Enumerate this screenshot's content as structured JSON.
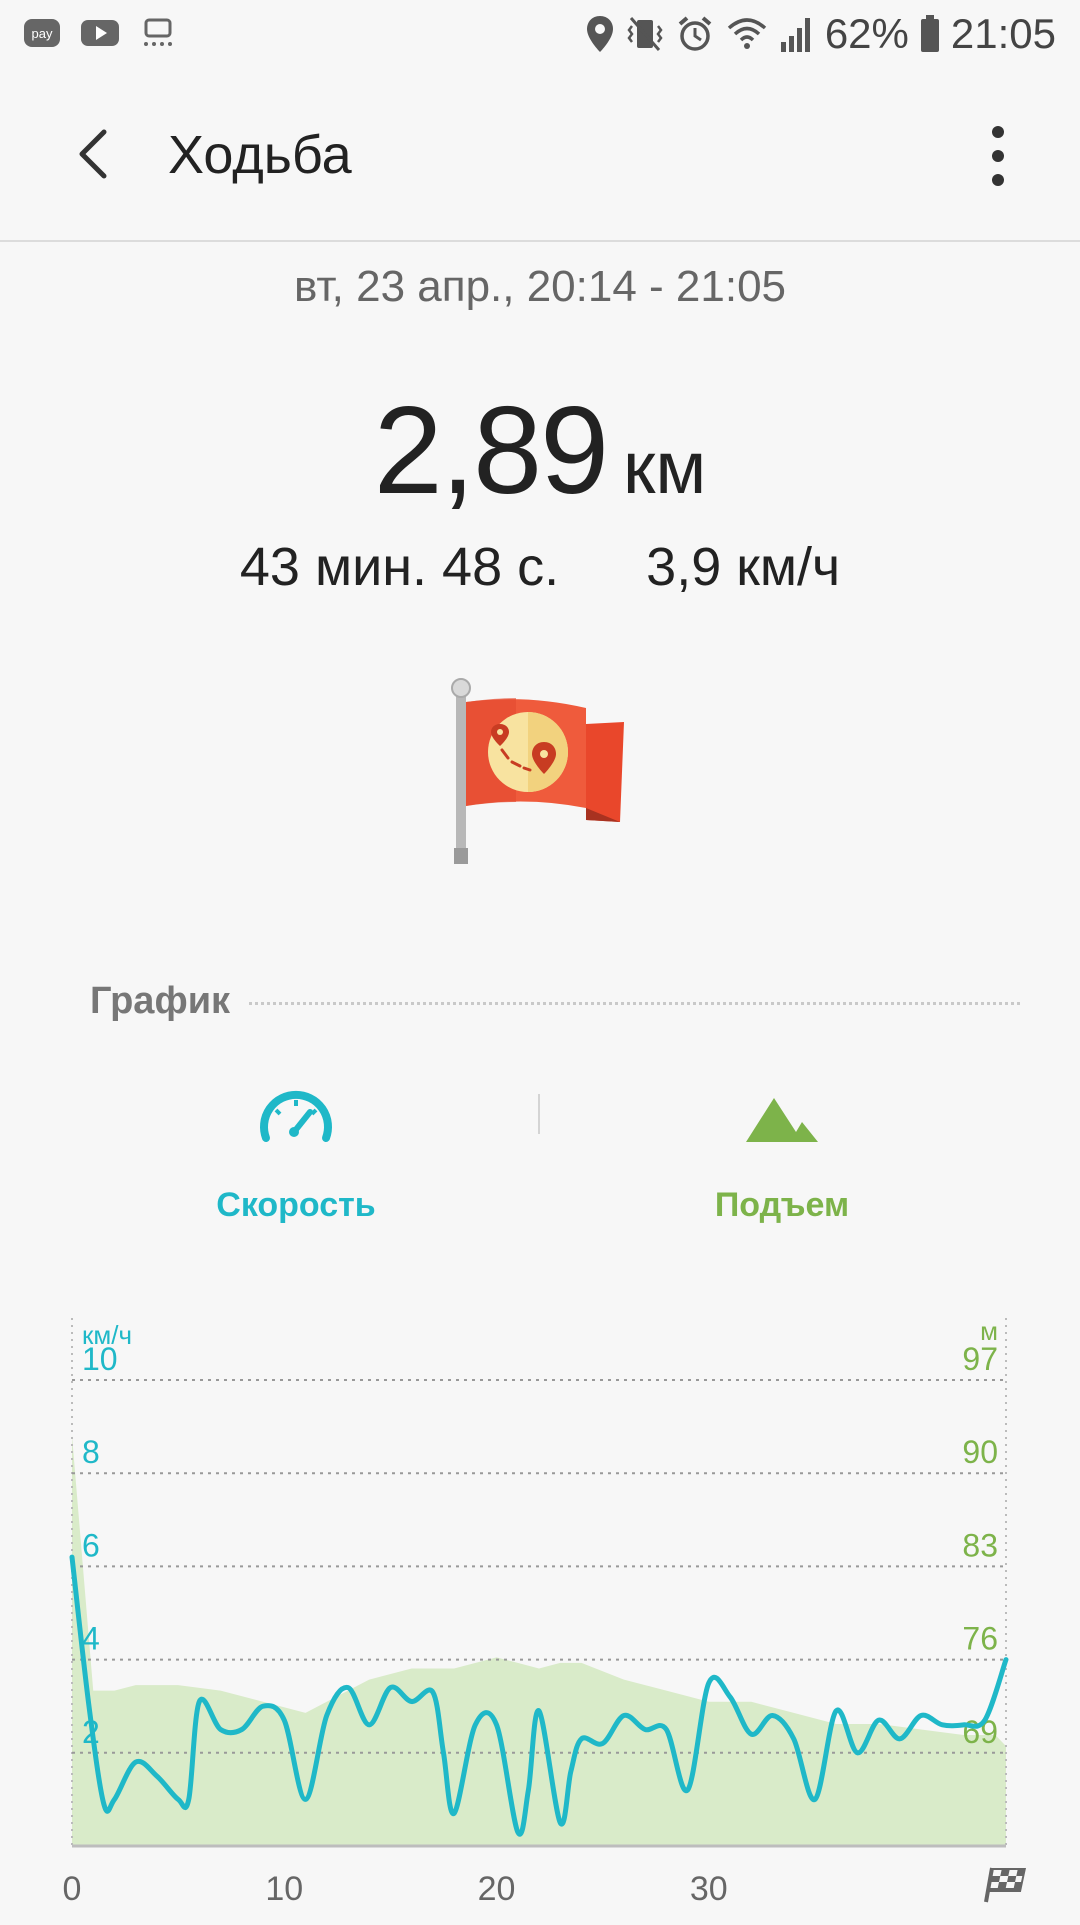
{
  "status": {
    "battery": "62%",
    "time": "21:05",
    "left_icons": [
      "pay-icon",
      "youtube-icon",
      "screen-share-icon"
    ],
    "right_icons": [
      "location-icon",
      "vibrate-icon",
      "alarm-icon",
      "wifi-icon",
      "signal-icon",
      "battery-icon"
    ]
  },
  "appbar": {
    "title": "Ходьба"
  },
  "workout": {
    "date": "вт, 23 апр., 20:14 - 21:05",
    "distance_value": "2,89",
    "distance_unit": "км",
    "duration": "43 мин. 48 с.",
    "avg_speed": "3,9 км/ч"
  },
  "section": {
    "graph_label": "График"
  },
  "modes": {
    "speed": "Скорость",
    "elevation": "Подъем"
  },
  "colors": {
    "speed": "#1fb8c8",
    "elevation": "#7db34a",
    "elevation_fill": "#d9ebc9"
  },
  "chart_data": {
    "type": "line",
    "left_unit": "км/ч",
    "right_unit": "м",
    "x_ticks": [
      "0",
      "10",
      "20",
      "30"
    ],
    "xlim": [
      0,
      44
    ],
    "left_ticks": [
      "10",
      "8",
      "6",
      "4",
      "2"
    ],
    "right_ticks": [
      "97",
      "90",
      "83",
      "76",
      "69"
    ],
    "left_ylim": [
      0,
      10
    ],
    "right_ylim": [
      55,
      97
    ],
    "grid": true,
    "series": [
      {
        "name": "Скорость",
        "axis": "left",
        "x": [
          0,
          0.8,
          1.5,
          2,
          3,
          4,
          5,
          5.5,
          6,
          7,
          8,
          9,
          10,
          11,
          12,
          13,
          14,
          15,
          16,
          17,
          17.5,
          18,
          19,
          20,
          21,
          21.5,
          22,
          23,
          23.5,
          24,
          25,
          26,
          27,
          28,
          29,
          30,
          31,
          32,
          33,
          34,
          35,
          36,
          37,
          38,
          39,
          40,
          41,
          42,
          43,
          44
        ],
        "values": [
          6.2,
          3.0,
          0.9,
          1.0,
          1.8,
          1.5,
          1.0,
          1.0,
          3.1,
          2.5,
          2.5,
          3.0,
          2.7,
          1.0,
          2.8,
          3.4,
          2.6,
          3.4,
          3.1,
          3.3,
          2.0,
          0.7,
          2.6,
          2.6,
          0.3,
          1.2,
          2.9,
          0.5,
          1.6,
          2.3,
          2.2,
          2.8,
          2.5,
          2.5,
          1.2,
          3.5,
          3.2,
          2.4,
          2.8,
          2.3,
          1.0,
          2.9,
          2.0,
          2.7,
          2.3,
          2.8,
          2.6,
          2.6,
          2.7,
          4.0
        ]
      },
      {
        "name": "Подъем",
        "axis": "right",
        "x": [
          0,
          1,
          2,
          3,
          5,
          7,
          9,
          11,
          12,
          13,
          14,
          16,
          18,
          20,
          21,
          22,
          23,
          24,
          26,
          28,
          30,
          32,
          34,
          36,
          38,
          40,
          42,
          43.5,
          44
        ],
        "values": [
          92,
          69,
          69,
          69.5,
          69.5,
          69,
          68,
          67,
          68,
          69,
          70,
          71,
          71,
          72,
          71.5,
          71,
          71.5,
          71.5,
          70,
          69,
          68,
          68,
          67,
          66,
          66,
          65.5,
          65,
          65,
          64
        ]
      }
    ]
  }
}
